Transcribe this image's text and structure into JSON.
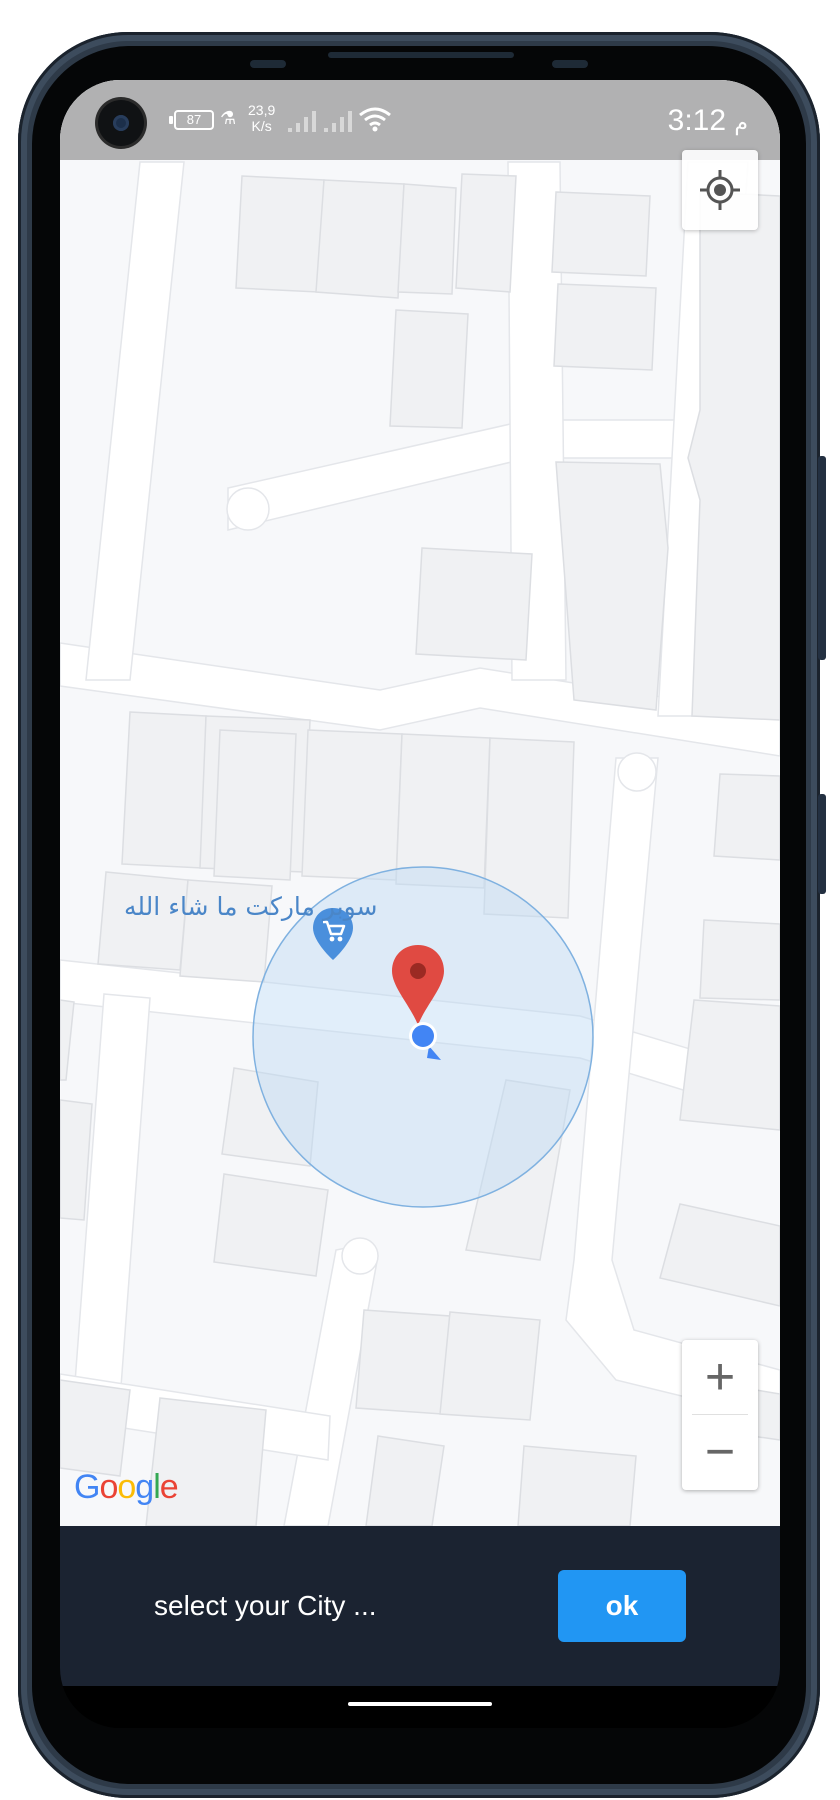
{
  "status_bar": {
    "battery_level": "87",
    "net_speed_value": "23,9",
    "net_speed_unit": "K/s",
    "time": "3:12",
    "time_suffix": "م"
  },
  "map": {
    "poi_label": "سوبر ماركت ما شاء الله",
    "poi_icon": "shopping-cart-icon",
    "zoom_in_label": "+",
    "zoom_out_label": "−",
    "logo_letters": [
      "G",
      "o",
      "o",
      "g",
      "l",
      "e"
    ],
    "logo_colors": [
      "#4285F4",
      "#EA4335",
      "#FBBC05",
      "#4285F4",
      "#34A853",
      "#EA4335"
    ],
    "marker_color": "#E04A42",
    "user_dot_color": "#4285F4",
    "accuracy_circle_color": "#BBD9F3"
  },
  "bottom_bar": {
    "prompt": "select your City ...",
    "ok_label": "ok",
    "ok_color": "#2196F3"
  }
}
